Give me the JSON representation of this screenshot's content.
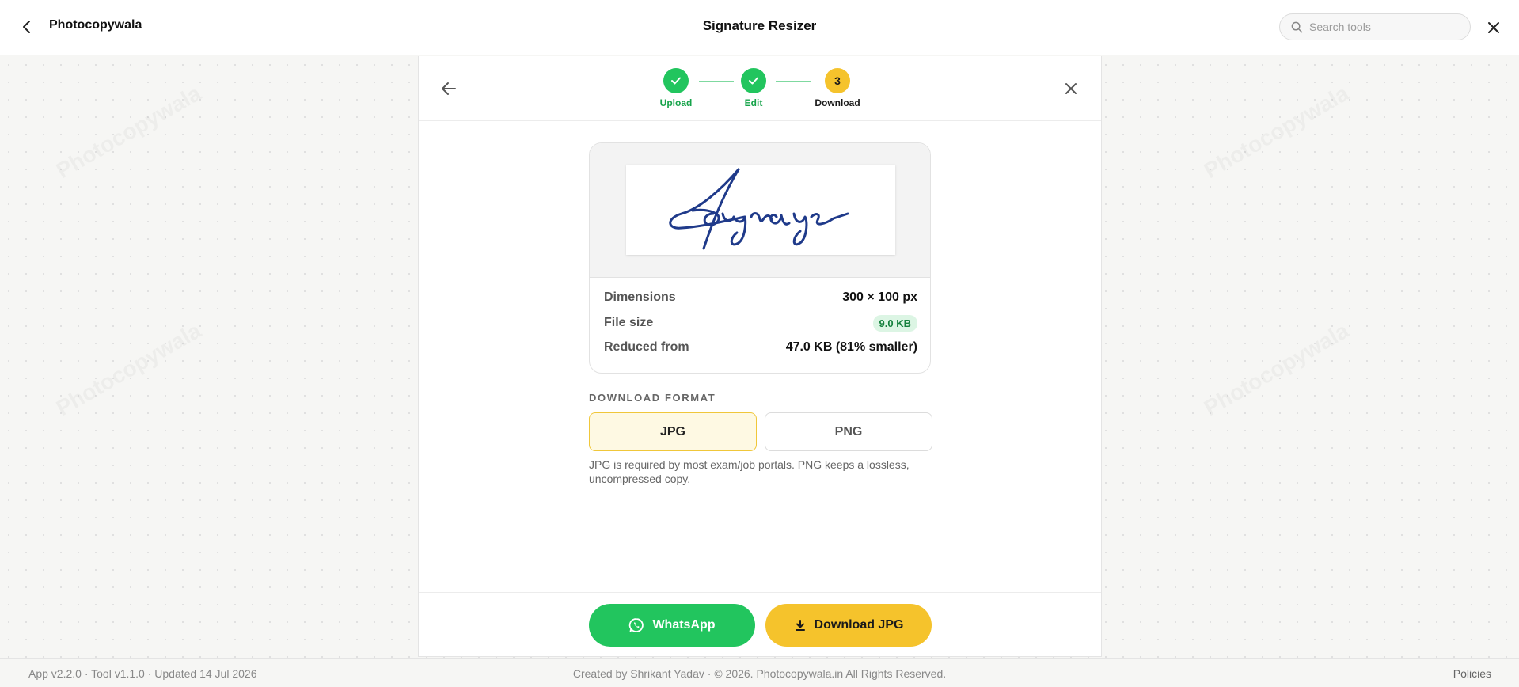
{
  "header": {
    "brand": "Photocopywala",
    "title": "Signature Resizer",
    "search_placeholder": "Search tools"
  },
  "watermark": "Photocopywala",
  "steps": [
    {
      "label": "Upload",
      "state": "done"
    },
    {
      "label": "Edit",
      "state": "done"
    },
    {
      "label": "Download",
      "number": "3",
      "state": "current"
    }
  ],
  "result": {
    "rows": [
      {
        "label": "Dimensions",
        "value": "300 × 100 px"
      },
      {
        "label": "File size",
        "value": "9.0 KB"
      },
      {
        "label": "Reduced from",
        "value": "47.0 KB (81% smaller)"
      }
    ]
  },
  "format": {
    "label": "DOWNLOAD FORMAT",
    "options": [
      "JPG",
      "PNG"
    ],
    "selected": "JPG",
    "note": "JPG is required by most exam/job portals. PNG keeps a lossless, uncompressed copy."
  },
  "actions": {
    "whatsapp": "WhatsApp",
    "download": "Download JPG"
  },
  "footer": {
    "left": "App v2.2.0 · Tool v1.1.0 · Updated 14 Jul 2026",
    "center": "Created by Shrikant Yadav · © 2026. Photocopywala.in All Rights Reserved.",
    "right": "Policies"
  },
  "colors": {
    "success": "#22c55e",
    "accent": "#f5c32c",
    "signature_ink": "#1f3a8a"
  }
}
